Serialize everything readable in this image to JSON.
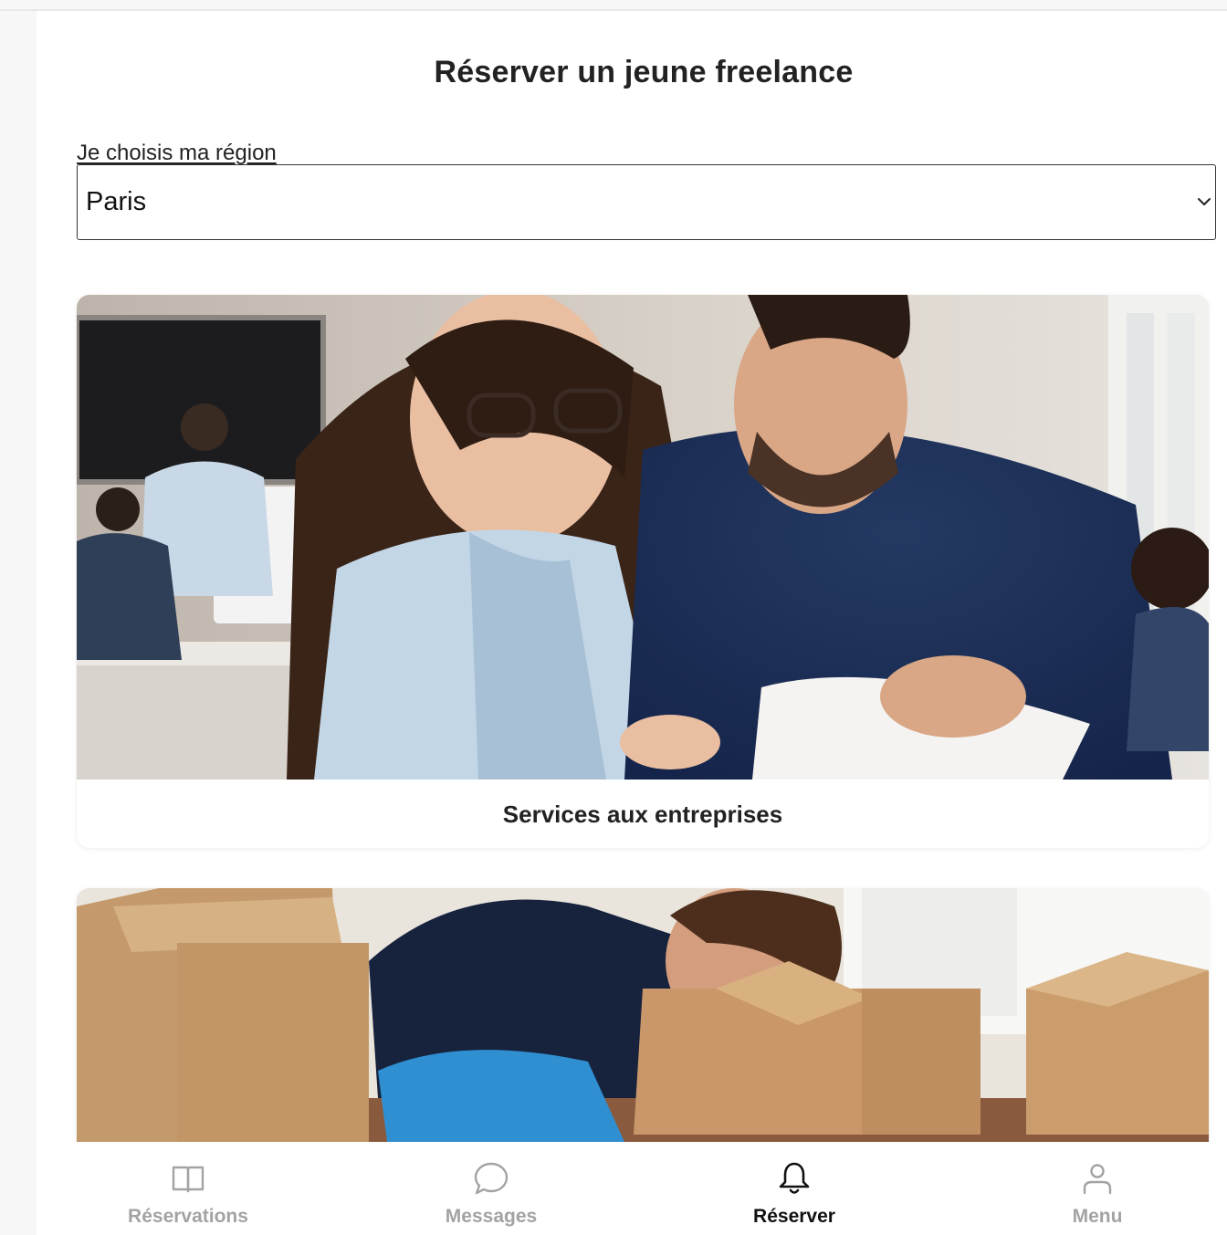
{
  "page": {
    "title": "Réserver un jeune freelance"
  },
  "region": {
    "label": "Je choisis ma région",
    "selected": "Paris"
  },
  "cards": [
    {
      "label": "Services aux entreprises",
      "image": "business-team-photo"
    },
    {
      "label": "",
      "image": "moving-boxes-photo"
    }
  ],
  "nav": {
    "items": [
      {
        "label": "Réservations",
        "icon": "book-icon",
        "active": false
      },
      {
        "label": "Messages",
        "icon": "chat-bubble-icon",
        "active": false
      },
      {
        "label": "Réserver",
        "icon": "bell-icon",
        "active": true
      },
      {
        "label": "Menu",
        "icon": "user-icon",
        "active": false
      }
    ]
  },
  "colors": {
    "active": "#111111",
    "inactive": "#a3a3a3"
  }
}
